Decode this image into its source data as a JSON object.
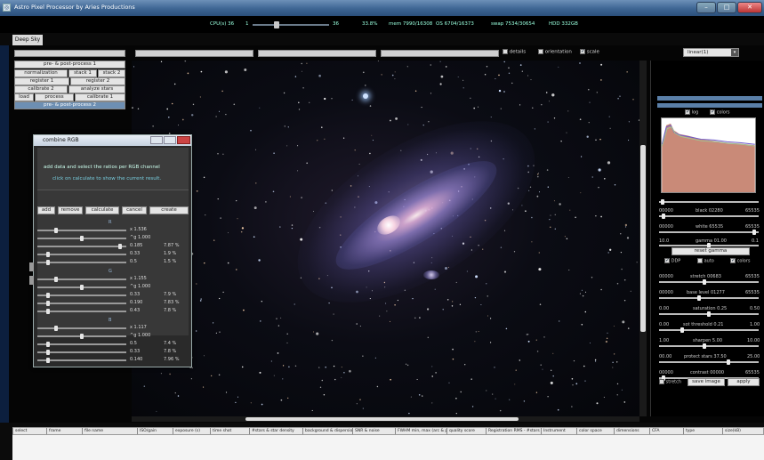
{
  "window": {
    "title": "Astro Pixel Processor by  Aries Productions",
    "minimize_label": "–",
    "maximize_label": "□",
    "close_label": "✕"
  },
  "appbar": {
    "cpu_label": "CPU(s) 36",
    "cpu_value": "1",
    "cpu_pct": "36",
    "cpu_pct_fraction": 0.3,
    "stat1": "33.8%",
    "stat2": "mem 7990/16308",
    "stat3": "OS 6704/16373",
    "stat4": "swap 7534/30654",
    "stat5": "HDD 332GB"
  },
  "tabs": {
    "deep_sky": "Deep Sky"
  },
  "toolbar": {
    "details_label": "details",
    "orientation_label": "orientation",
    "scale_label": "scale",
    "details_checked": false,
    "orientation_checked": false,
    "scale_checked": true,
    "stretch_select": "linear(1)",
    "stretch_arrow": "▾"
  },
  "left_nav": {
    "pre_post": "pre- & post-process 1",
    "normalization": "normalization",
    "stack1": "stack 1",
    "stack2": "stack 2",
    "register1": "register 1",
    "register2": "register 2",
    "calibrate2": "calibrate 2",
    "analyze_stars": "analyze stars",
    "load": "load",
    "process": "process",
    "calibrate1": "calibrate 1",
    "pre_post2": "pre- & post-process 2"
  },
  "dialog": {
    "title": "combine RGB",
    "msg1": "add data and select the ratios per RGB channel",
    "msg2": "click on calculate to show the current result.",
    "btn_add": "add",
    "btn_remove": "remove",
    "btn_calculate": "calculate",
    "btn_cancel": "cancel",
    "btn_create": "create",
    "channels": [
      {
        "head": "R",
        "mult": "x 1.536",
        "gamma": "^g 1.000",
        "v1": "0.185",
        "p1": "7.87 %",
        "v2": "0.33",
        "p2": "1.9 %",
        "v3": "0.5",
        "p3": "1.5 %",
        "thumb": [
          0.2,
          0.5,
          0.95,
          0.1,
          0.1,
          0.1
        ]
      },
      {
        "head": "G",
        "mult": "x 1.155",
        "gamma": "^g 1.000",
        "v1": "0.33",
        "p1": "7.9 %",
        "v2": "0.190",
        "p2": "7.83 %",
        "v3": "0.43",
        "p3": "7.8 %",
        "thumb": [
          0.2,
          0.5,
          0.1,
          0.1,
          0.1,
          0.1
        ]
      },
      {
        "head": "B",
        "mult": "x 1.117",
        "gamma": "^g 1.000",
        "v1": "0.5",
        "p1": "7.4 %",
        "v2": "0.33",
        "p2": "7.8 %",
        "v3": "0.140",
        "p3": "7.96 %",
        "thumb": [
          0.2,
          0.5,
          0.1,
          0.1,
          0.1,
          0.95
        ]
      }
    ]
  },
  "right_panel": {
    "log_label": "log",
    "colors_label": "colors",
    "log_checked": true,
    "colors_checked": true,
    "black_left": "00000",
    "black_label": "black 02280",
    "black_right": "65535",
    "black_pos": 0.03,
    "white_left": "00000",
    "white_label": "white 65535",
    "white_right": "65535",
    "white_pos": 0.97,
    "gamma_left": "10.0",
    "gamma_label": "gamma 01.00",
    "gamma_right": "0.1",
    "gamma_pos": 0.5,
    "reset_gamma": "reset gamma",
    "ddp_label": "DDP",
    "ddp_checked": true,
    "auto_label": "auto",
    "auto_checked": false,
    "colors2_label": "colors",
    "colors2_checked": true,
    "stretch_left": "00000",
    "stretch_label": "stretch 00683",
    "stretch_right": "65535",
    "stretch_pos": 0.45,
    "base_left": "00000",
    "base_label": "base level 01277",
    "base_right": "65535",
    "base_pos": 0.4,
    "sat_left": "0.00",
    "sat_label": "saturation 0.25",
    "sat_right": "0.50",
    "sat_pos": 0.5,
    "sot_left": "0.00",
    "sot_label": "sot   threshold 0.21",
    "sot_right": "1.00",
    "sot_pos": 0.22,
    "sharpen_left": "1.00",
    "sharpen_label": "sharpen 5.00",
    "sharpen_right": "10.00",
    "sharpen_pos": 0.45,
    "protect_left": "00.00",
    "protect_label": "protect stars 37.50",
    "protect_right": "25.00",
    "protect_pos": 0.7,
    "contrast_left": "00000",
    "contrast_label": "contrast 00000",
    "contrast_right": "65535",
    "contrast_pos": 0.03,
    "stretch_chk_label": "stretch",
    "save_image": "save image",
    "apply": "apply"
  },
  "table": {
    "headers": [
      "select",
      "frame",
      "file name",
      "ISO/gain",
      "exposure (s)",
      "time shot",
      "#stars & star density",
      "background & dispersion",
      "SNR & noise",
      "FWHM min, max (arc & px)",
      "quality score",
      "Registration RMS - #stars",
      "Instrument",
      "color space",
      "dimensions",
      "CFA",
      "type",
      "size(kB)"
    ]
  }
}
